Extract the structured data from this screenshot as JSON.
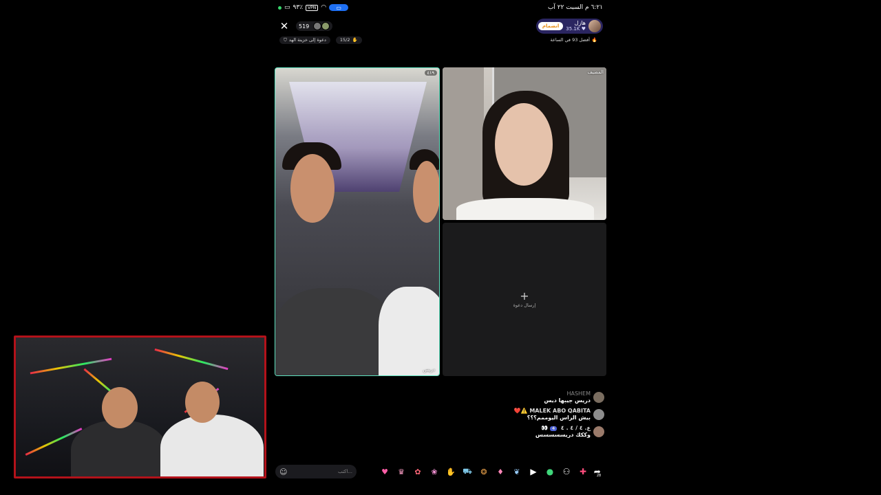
{
  "status_bar": {
    "time_date": "٦:٢١ م  السبت ٢٢ آب",
    "vpn_label": "VPN",
    "battery": "٩٣٪"
  },
  "header": {
    "viewer_count": "519",
    "host_name": "هازل",
    "host_likes": "35.1K",
    "follow_label": "انضمام",
    "rank_text": "أفضل 93 في الساعة",
    "invite_chip": "دعوة إلى خزينة الهد",
    "seats_chip": "15/2"
  },
  "tiles": {
    "guest_count": "٤١٩",
    "guest_name": "دريس",
    "host_label": "المضيف",
    "empty_invite_label": "إرسال دعوة",
    "empty_plus": "+"
  },
  "chat": [
    {
      "user": "HASHEM",
      "text": "دريس جيبها ديس",
      "badges": ""
    },
    {
      "user": "MALEK ABO QABITA",
      "text": "بيش الراس اليوممم؟؟؟",
      "badges": "❤️⚠️"
    },
    {
      "user": "ع. ٤ / ٤ . ٤",
      "text": "وككك دريسسسسس",
      "badges": "👀",
      "level": "4"
    }
  ],
  "bottom_bar": {
    "comment_placeholder": "اكتب...",
    "emoji_icon": "☺",
    "share_count": "28"
  },
  "colors": {
    "guest_border": "#5fe3c0",
    "overlay_border": "#b3121a",
    "host_card": "#2a2560"
  }
}
